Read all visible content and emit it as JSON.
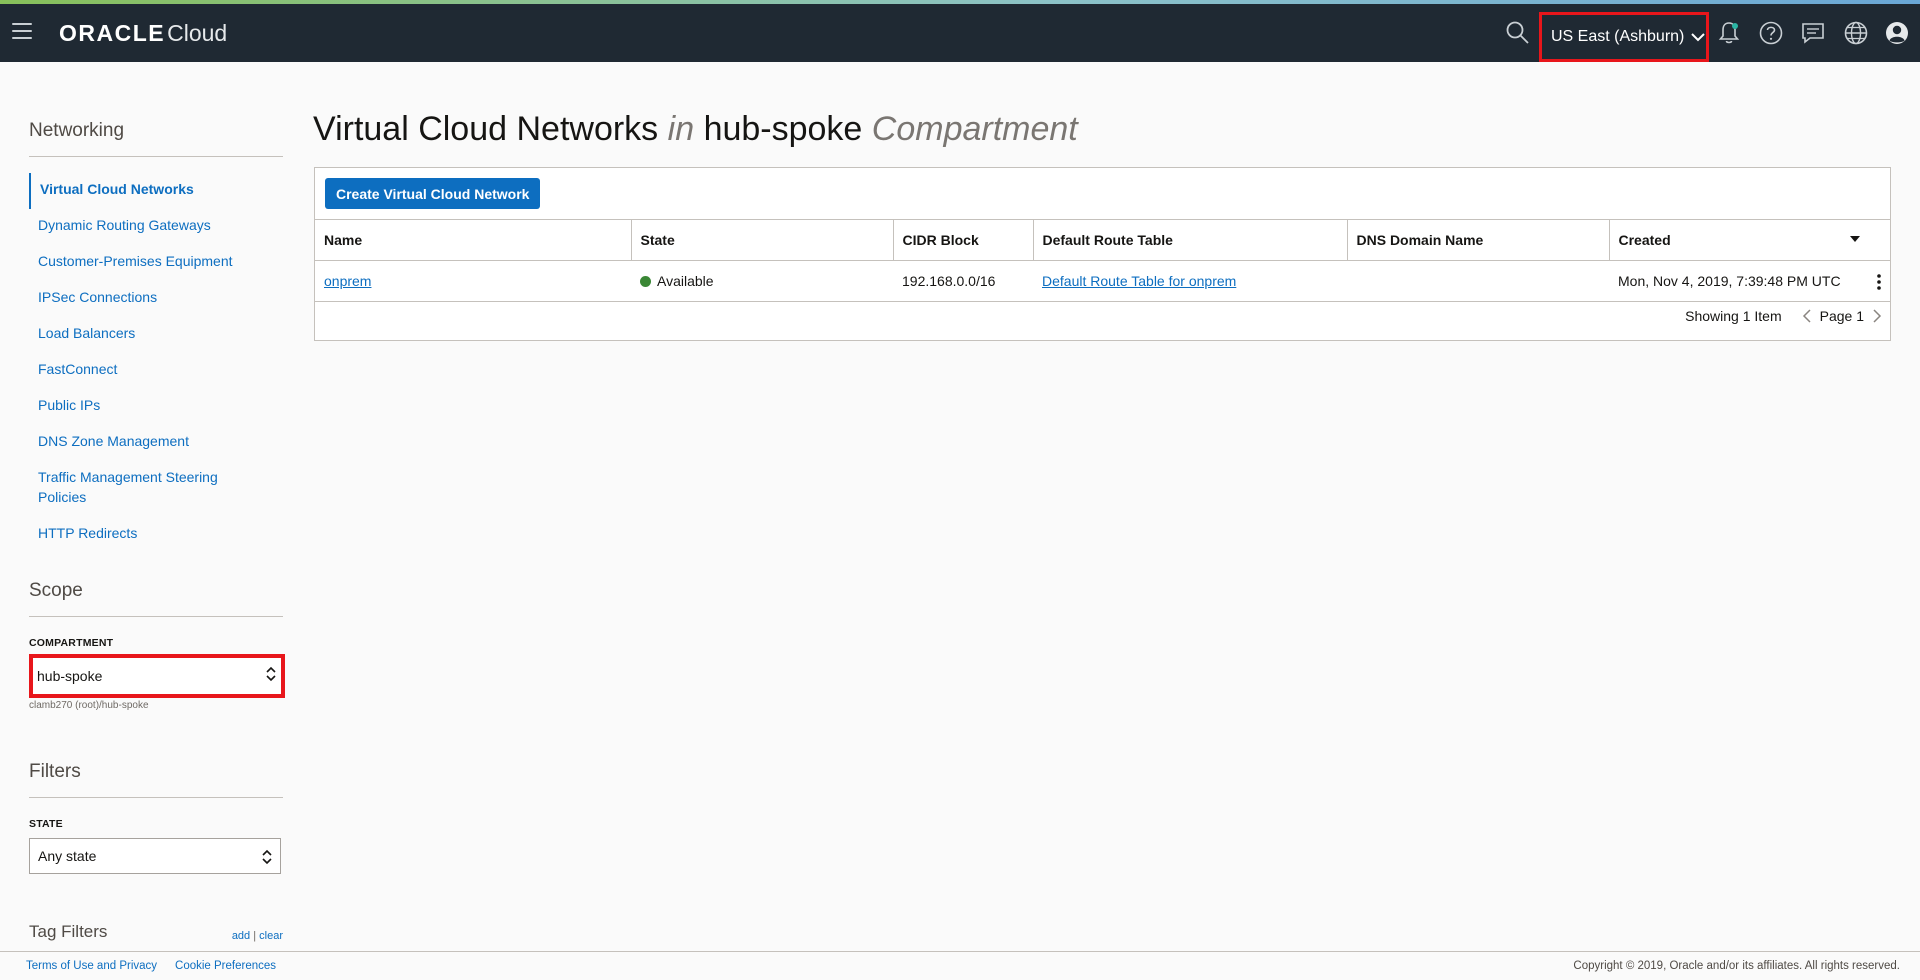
{
  "header": {
    "logo_brand": "ORACLE",
    "logo_product": "Cloud",
    "region": "US East (Ashburn)",
    "icons": [
      "menu-icon",
      "search-icon",
      "bell-icon",
      "help-icon",
      "chat-icon",
      "globe-icon",
      "user-icon"
    ]
  },
  "sidebar": {
    "networking_title": "Networking",
    "items": [
      {
        "label": "Virtual Cloud Networks",
        "active": true
      },
      {
        "label": "Dynamic Routing Gateways"
      },
      {
        "label": "Customer-Premises Equipment"
      },
      {
        "label": "IPSec Connections"
      },
      {
        "label": "Load Balancers"
      },
      {
        "label": "FastConnect"
      },
      {
        "label": "Public IPs"
      },
      {
        "label": "DNS Zone Management"
      },
      {
        "label": "Traffic Management Steering Policies"
      },
      {
        "label": "HTTP Redirects"
      }
    ],
    "scope_title": "Scope",
    "compartment_label": "COMPARTMENT",
    "compartment_value": "hub-spoke",
    "compartment_path": "clamb270 (root)/hub-spoke",
    "filters_title": "Filters",
    "state_label": "STATE",
    "state_value": "Any state",
    "tag_filters_title": "Tag Filters",
    "tag_add": "add",
    "tag_sep": "|",
    "tag_clear": "clear"
  },
  "main": {
    "title_main": "Virtual Cloud Networks",
    "title_in": "in",
    "title_compartment": "hub-spoke",
    "title_suffix": "Compartment",
    "create_button": "Create Virtual Cloud Network",
    "columns": [
      "Name",
      "State",
      "CIDR Block",
      "Default Route Table",
      "DNS Domain Name",
      "Created"
    ],
    "rows": [
      {
        "name": "onprem",
        "state": "Available",
        "cidr": "192.168.0.0/16",
        "route_table": "Default Route Table for onprem",
        "dns": "",
        "created": "Mon, Nov 4, 2019, 7:39:48 PM UTC"
      }
    ],
    "showing": "Showing 1 Item",
    "page": "Page 1"
  },
  "footer": {
    "terms": "Terms of Use and Privacy",
    "cookies": "Cookie Preferences",
    "copyright": "Copyright © 2019, Oracle and/or its affiliates. All rights reserved."
  },
  "colors": {
    "topbar": "#1f2933",
    "link": "#0d6ec0",
    "highlight": "#e8161b",
    "available": "#3a8735"
  }
}
